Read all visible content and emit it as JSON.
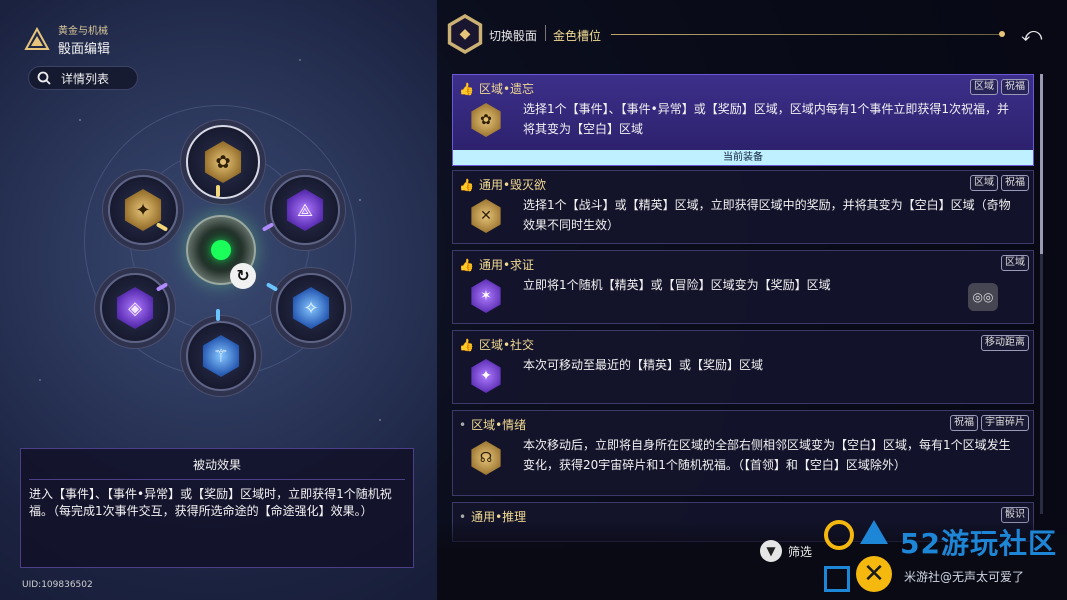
{
  "header": {
    "subtitle": "黄金与机械",
    "title": "骰面编辑",
    "search_label": "详情列表"
  },
  "passive": {
    "heading": "被动效果",
    "body": "进入【事件】、【事件•异常】或【奖励】区域时，立即获得1个随机祝福。（每完成1次事件交互，获得所选命途的【命途强化】效果。）"
  },
  "uid": "UID:109836502",
  "topbar": {
    "switch_label": "切换骰面",
    "slot_label": "金色槽位"
  },
  "cards": [
    {
      "title": "区域•遗忘",
      "tags": [
        "区域",
        "祝福"
      ],
      "text": "选择1个【事件】、【事件•异常】或【奖励】区域，区域内每有1个事件立即获得1次祝福，并将其变为【空白】区域",
      "equipped": "当前装备"
    },
    {
      "title": "通用•毁灭欲",
      "tags": [
        "区域",
        "祝福"
      ],
      "text": "选择1个【战斗】或【精英】区域，立即获得区域中的奖励，并将其变为【空白】区域（奇物效果不同时生效）"
    },
    {
      "title": "通用•求证",
      "tags": [
        "区域"
      ],
      "text": "立即将1个随机【精英】或【冒险】区域变为【奖励】区域"
    },
    {
      "title": "区域•社交",
      "tags": [
        "移动距离"
      ],
      "text": "本次可移动至最近的【精英】或【奖励】区域"
    },
    {
      "title": "区域•情绪",
      "tags": [
        "祝福",
        "宇宙碎片"
      ],
      "text": "本次移动后，立即将自身所在区域的全部右侧相邻区域变为【空白】区域，每有1个区域发生变化，获得20宇宙碎片和1个随机祝福。（【首领】和【空白】区域除外）"
    },
    {
      "title": "通用•推理",
      "tags": [
        "骰识"
      ]
    }
  ],
  "filter_label": "筛选",
  "watermark": {
    "brand": "52游玩社区",
    "sub": "米游社@无声太可爱了"
  },
  "icons": {
    "logo": "gold-mech-emblem-icon",
    "search": "search-icon",
    "back": "back-arrow-icon",
    "filter": "filter-icon",
    "reset": "refresh-icon"
  },
  "colors": {
    "accent_gold": "#e6c47a",
    "active_card": "#3c2f8a",
    "equipped_bar": "#bff0ff",
    "center_core": "#1aff5a"
  }
}
